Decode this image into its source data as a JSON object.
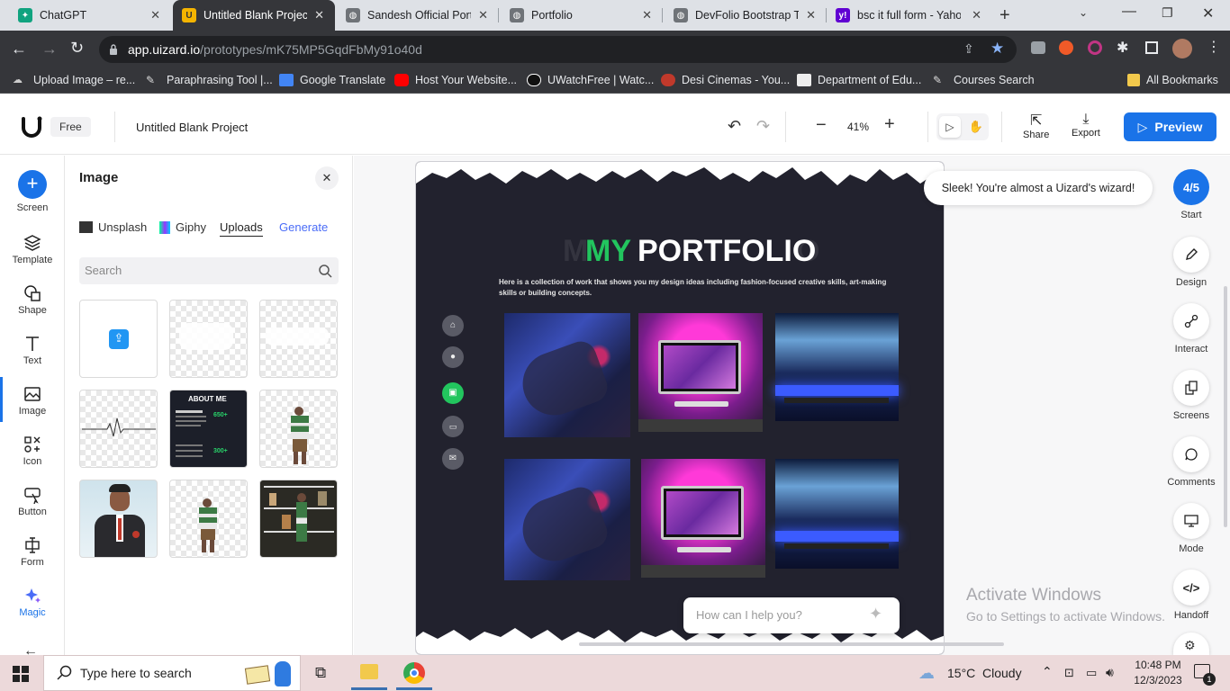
{
  "browser": {
    "tabs": [
      {
        "title": "ChatGPT",
        "active": false
      },
      {
        "title": "Untitled Blank Project",
        "active": true
      },
      {
        "title": "Sandesh Official Portf",
        "active": false
      },
      {
        "title": "Portfolio",
        "active": false
      },
      {
        "title": "DevFolio Bootstrap Te",
        "active": false
      },
      {
        "title": "bsc it full form - Yaho",
        "active": false
      }
    ],
    "url_host": "app.uizard.io",
    "url_path": "/prototypes/mK75MP5GqdFbMy91o40d",
    "bookmarks": [
      "Upload Image – re...",
      "Paraphrasing Tool |...",
      "Google Translate",
      "Host Your Website...",
      "UWatchFree | Watc...",
      "Desi Cinemas - You...",
      "Department of Edu...",
      "Courses Search",
      "All Bookmarks"
    ]
  },
  "app": {
    "plan_badge": "Free",
    "project_title": "Untitled Blank Project",
    "zoom": "41%",
    "share_label": "Share",
    "export_label": "Export",
    "preview_label": "Preview",
    "accent_color": "#1a73e8"
  },
  "left_rail": {
    "items": [
      "Screen",
      "Template",
      "Shape",
      "Text",
      "Image",
      "Icon",
      "Button",
      "Form",
      "Magic"
    ]
  },
  "image_panel": {
    "title": "Image",
    "tabs": [
      "Unsplash",
      "Giphy",
      "Uploads",
      "Generate"
    ],
    "active_tab": "Uploads",
    "search_placeholder": "Search",
    "about_tile": {
      "title": "ABOUT ME",
      "stat1": "650+",
      "stat2": "300+"
    }
  },
  "canvas": {
    "portfolio_title_part1": "MY",
    "portfolio_title_part2": "PORTFOLIO",
    "shadow_left": "M",
    "shadow_right": "O",
    "description": "Here is a collection of work that shows you my design ideas including fashion-focused creative skills, art-making skills or building concepts.",
    "chat_placeholder": "How can I help you?",
    "toast": "Sleek! You're almost a Uizard's wizard!",
    "watermark_title": "Activate Windows",
    "watermark_sub": "Go to Settings to activate Windows."
  },
  "right_rail": {
    "progress_label": "4/5",
    "start_label": "Start",
    "items": [
      "Design",
      "Interact",
      "Screens",
      "Comments",
      "Mode",
      "Handoff"
    ]
  },
  "taskbar": {
    "search_placeholder": "Type here to search",
    "weather_temp": "15°C",
    "weather_desc": "Cloudy",
    "time": "10:48 PM",
    "date": "12/3/2023",
    "notification_count": "1"
  }
}
